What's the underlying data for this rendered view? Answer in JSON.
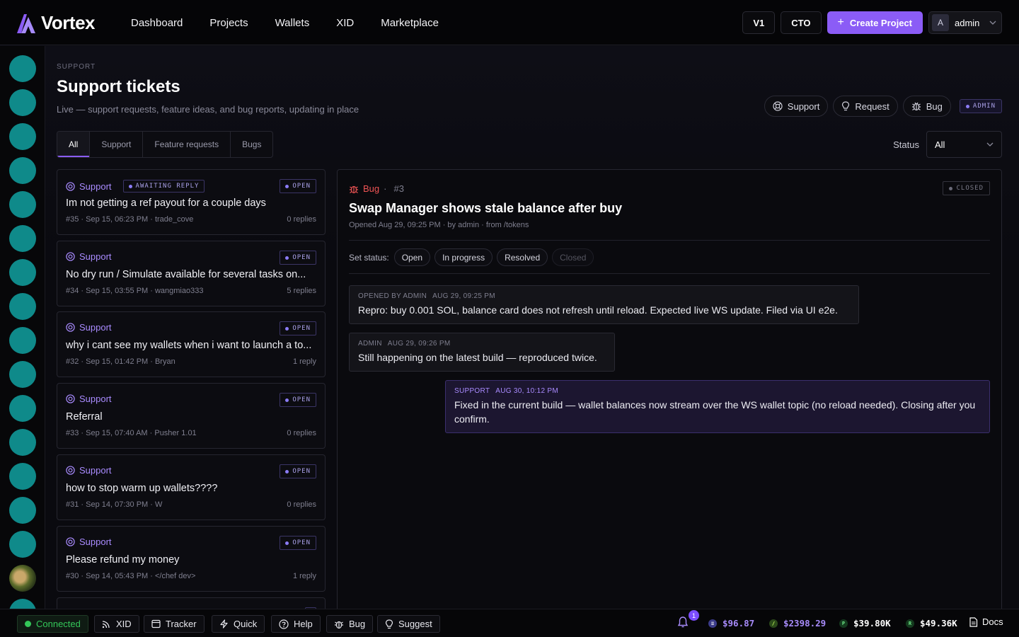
{
  "app": {
    "name": "Vortex"
  },
  "nav": [
    "Dashboard",
    "Projects",
    "Wallets",
    "XID",
    "Marketplace"
  ],
  "topbar": {
    "v1": "V1",
    "cto": "CTO",
    "create": "Create Project",
    "user_initial": "A",
    "user_name": "admin"
  },
  "colors": {
    "accent": "#8b5cf6",
    "teal": "#0f8a8a",
    "bug": "#ef5454",
    "connected": "#34c759"
  },
  "page": {
    "eyebrow": "SUPPORT",
    "title": "Support tickets",
    "subtitle": "Live — support requests, feature ideas, and bug reports, updating in place",
    "actions": {
      "support": "Support",
      "request": "Request",
      "bug": "Bug",
      "admin": "ADMIN"
    },
    "tabs": [
      "All",
      "Support",
      "Feature requests",
      "Bugs"
    ],
    "status_label": "Status",
    "status_value": "All"
  },
  "tickets": [
    {
      "category": "Support",
      "awaiting": "AWAITING REPLY",
      "status": "OPEN",
      "title": "Im not getting a ref payout for a couple days",
      "meta": "#35 · Sep 15, 06:23 PM · trade_cove",
      "replies": "0 replies"
    },
    {
      "category": "Support",
      "awaiting": "",
      "status": "OPEN",
      "title": "No dry run / Simulate available for several tasks on...",
      "meta": "#34 · Sep 15, 03:55 PM · wangmiao333",
      "replies": "5 replies"
    },
    {
      "category": "Support",
      "awaiting": "",
      "status": "OPEN",
      "title": "why i cant see my wallets when i want to launch a to...",
      "meta": "#32 · Sep 15, 01:42 PM · Bryan",
      "replies": "1 reply"
    },
    {
      "category": "Support",
      "awaiting": "",
      "status": "OPEN",
      "title": "Referral",
      "meta": "#33 · Sep 15, 07:40 AM · Pusher 1.01",
      "replies": "0 replies"
    },
    {
      "category": "Support",
      "awaiting": "",
      "status": "OPEN",
      "title": "how to stop warm up wallets????",
      "meta": "#31 · Sep 14, 07:30 PM · W",
      "replies": "0 replies"
    },
    {
      "category": "Support",
      "awaiting": "",
      "status": "OPEN",
      "title": "Please refund my money",
      "meta": "#30 · Sep 14, 05:43 PM · </chef dev>",
      "replies": "1 reply"
    }
  ],
  "detail": {
    "category": "Bug",
    "number": "#3",
    "status": "CLOSED",
    "title": "Swap Manager shows stale balance after buy",
    "meta": "Opened Aug 29, 09:25 PM · by admin · from /tokens",
    "set_status_label": "Set status:",
    "status_options": [
      "Open",
      "In progress",
      "Resolved",
      "Closed"
    ],
    "messages": [
      {
        "author": "OPENED BY ADMIN",
        "time": "AUG 29, 09:25 PM",
        "body": "Repro: buy 0.001 SOL, balance card does not refresh until reload. Expected live WS update. Filed via UI e2e."
      },
      {
        "author": "ADMIN",
        "time": "AUG 29, 09:26 PM",
        "body": "Still happening on the latest build — reproduced twice."
      },
      {
        "author": "SUPPORT",
        "time": "AUG 30, 10:12 PM",
        "body": "Fixed in the current build — wallet balances now stream over the WS wallet topic (no reload needed). Closing after you confirm."
      }
    ]
  },
  "footer": {
    "connected": "Connected",
    "buttons": [
      "XID",
      "Tracker",
      "Quick",
      "Help",
      "Bug",
      "Suggest"
    ],
    "notifications": "1",
    "prices": [
      {
        "symbol": "S",
        "value": "$96.87",
        "color": "#a78bfa"
      },
      {
        "symbol": "E",
        "value": "$2398.29",
        "color": "#a78bfa"
      },
      {
        "symbol": "P",
        "value": "$39.80K",
        "color": "#ffffff"
      },
      {
        "symbol": "R",
        "value": "$49.36K",
        "color": "#ffffff"
      }
    ],
    "docs": "Docs"
  }
}
